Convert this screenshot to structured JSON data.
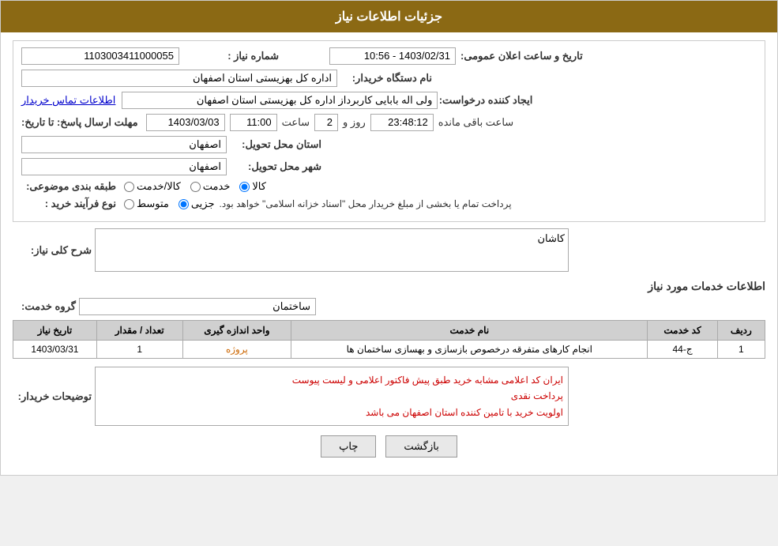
{
  "header": {
    "title": "جزئیات اطلاعات نیاز"
  },
  "fields": {
    "shomareNiaz_label": "شماره نیاز :",
    "shomareNiaz_value": "1103003411000055",
    "namDastgah_label": "نام دستگاه خریدار:",
    "namDastgah_value": "اداره کل بهزیستی استان اصفهان",
    "ijadKonande_label": "ایجاد کننده درخواست:",
    "ijadKonande_value": "ولی اله بابایی کاربرداز اداره کل بهزیستی استان اصفهان",
    "ettela_link": "اطلاعات تماس خریدار",
    "mohlatErsalPasokh_label": "مهلت ارسال پاسخ: تا تاریخ:",
    "date_value": "1403/03/03",
    "saat_label": "ساعت",
    "saat_value": "11:00",
    "rooz_label": "روز و",
    "rooz_value": "2",
    "remaining_value": "23:48:12",
    "remaining_label": "ساعت باقی مانده",
    "ostanMahale_label": "استان محل تحویل:",
    "ostanMahale_value": "اصفهان",
    "shahrMahale_label": "شهر محل تحویل:",
    "shahrMahale_value": "اصفهان",
    "tabaqebandi_label": "طبقه بندی موضوعی:",
    "radio_kala": "کالا",
    "radio_khedmat": "خدمت",
    "radio_kala_khedmat": "کالا/خدمت",
    "noeFarayand_label": "نوع فرآیند خرید :",
    "radio_jozi": "جزیی",
    "radio_motavaset": "متوسط",
    "noeFarayand_note": "پرداخت تمام یا بخشی از مبلغ خریدار محل \"اسناد خزانه اسلامی\" خواهد بود.",
    "tarikh_label": "تاریخ و ساعت اعلان عمومی:",
    "tarikh_value": "1403/02/31 - 10:56",
    "sharhKolliNiaz_label": "شرح کلی نیاز:",
    "sharhKolliNiaz_value": "کاشان",
    "ettelaatKhadamat_title": "اطلاعات خدمات مورد نیاز",
    "groheKhadamat_label": "گروه خدمت:",
    "groheKhadamat_value": "ساختمان",
    "table": {
      "headers": [
        "ردیف",
        "کد خدمت",
        "نام خدمت",
        "واحد اندازه گیری",
        "تعداد / مقدار",
        "تاریخ نیاز"
      ],
      "rows": [
        {
          "radif": "1",
          "kodKhadamat": "ج-44",
          "namKhadamat": "انجام کارهای متفرقه درخصوص بازسازی و بهسازی ساختمان ها",
          "vahed": "پروژه",
          "tedad": "1",
          "tarikh": "1403/03/31"
        }
      ]
    },
    "tozihKharidar_label": "توضیحات خریدار:",
    "tozihKharidar_line1": "ایران کد اعلامی مشابه خرید طبق پیش فاکتور اعلامی و لیست پیوست",
    "tozihKharidar_line2": "پرداخت نقدی",
    "tozihKharidar_line3": "اولویت خرید با تامین کننده استان اصفهان  می باشد",
    "btn_chap": "چاپ",
    "btn_bazgasht": "بازگشت"
  }
}
